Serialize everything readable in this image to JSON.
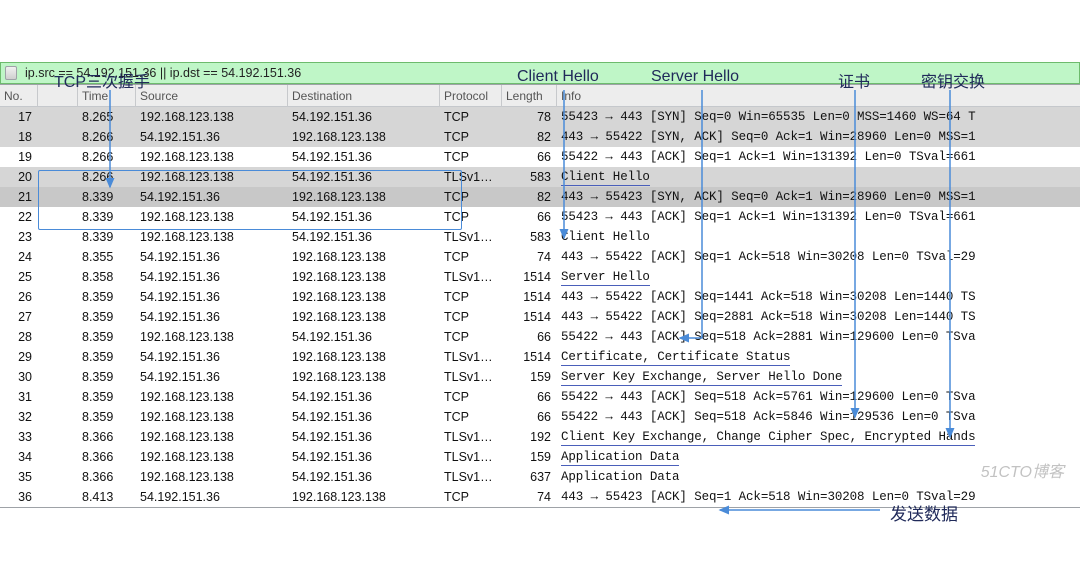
{
  "annotations": {
    "tcp_handshake": "TCP三次握手",
    "client_hello": "Client Hello",
    "server_hello": "Server Hello",
    "certificate": "证书",
    "key_exchange": "密钥交换",
    "send_data": "发送数据"
  },
  "filter": {
    "expression": "ip.src == 54.192.151.36 || ip.dst == 54.192.151.36"
  },
  "columns": {
    "c0": "No.",
    "c1": "",
    "c2": "Time",
    "c3": "Source",
    "c4": "Destination",
    "c5": "Protocol",
    "c6": "Length",
    "c7": "Info"
  },
  "rows": [
    {
      "no": "17",
      "time": "8.265",
      "src": "192.168.123.138",
      "dst": "54.192.151.36",
      "proto": "TCP",
      "len": "78",
      "info": "55423 → 443 [SYN] Seq=0 Win=65535 Len=0 MSS=1460 WS=64 T",
      "sel": true
    },
    {
      "no": "18",
      "time": "8.266",
      "src": "54.192.151.36",
      "dst": "192.168.123.138",
      "proto": "TCP",
      "len": "82",
      "info": "443 → 55422 [SYN, ACK] Seq=0 Ack=1 Win=28960 Len=0 MSS=1",
      "sel": true
    },
    {
      "no": "19",
      "time": "8.266",
      "src": "192.168.123.138",
      "dst": "54.192.151.36",
      "proto": "TCP",
      "len": "66",
      "info": "55422 → 443 [ACK] Seq=1 Ack=1 Win=131392 Len=0 TSval=661",
      "sel": false
    },
    {
      "no": "20",
      "time": "8.266",
      "src": "192.168.123.138",
      "dst": "54.192.151.36",
      "proto": "TLSv1…",
      "len": "583",
      "info": "Client Hello",
      "sel": true,
      "ul": true
    },
    {
      "no": "21",
      "time": "8.339",
      "src": "54.192.151.36",
      "dst": "192.168.123.138",
      "proto": "TCP",
      "len": "82",
      "info": "443 → 55423 [SYN, ACK] Seq=0 Ack=1 Win=28960 Len=0 MSS=1",
      "sel": true,
      "mark": true
    },
    {
      "no": "22",
      "time": "8.339",
      "src": "192.168.123.138",
      "dst": "54.192.151.36",
      "proto": "TCP",
      "len": "66",
      "info": "55423 → 443 [ACK] Seq=1 Ack=1 Win=131392 Len=0 TSval=661",
      "sel": false
    },
    {
      "no": "23",
      "time": "8.339",
      "src": "192.168.123.138",
      "dst": "54.192.151.36",
      "proto": "TLSv1…",
      "len": "583",
      "info": "Client Hello",
      "sel": false
    },
    {
      "no": "24",
      "time": "8.355",
      "src": "54.192.151.36",
      "dst": "192.168.123.138",
      "proto": "TCP",
      "len": "74",
      "info": "443 → 55422 [ACK] Seq=1 Ack=518 Win=30208 Len=0 TSval=29",
      "sel": false
    },
    {
      "no": "25",
      "time": "8.358",
      "src": "54.192.151.36",
      "dst": "192.168.123.138",
      "proto": "TLSv1…",
      "len": "1514",
      "info": "Server Hello",
      "sel": false,
      "ul": true
    },
    {
      "no": "26",
      "time": "8.359",
      "src": "54.192.151.36",
      "dst": "192.168.123.138",
      "proto": "TCP",
      "len": "1514",
      "info": "443 → 55422 [ACK] Seq=1441 Ack=518 Win=30208 Len=1440 TS",
      "sel": false
    },
    {
      "no": "27",
      "time": "8.359",
      "src": "54.192.151.36",
      "dst": "192.168.123.138",
      "proto": "TCP",
      "len": "1514",
      "info": "443 → 55422 [ACK] Seq=2881 Ack=518 Win=30208 Len=1440 TS",
      "sel": false
    },
    {
      "no": "28",
      "time": "8.359",
      "src": "192.168.123.138",
      "dst": "54.192.151.36",
      "proto": "TCP",
      "len": "66",
      "info": "55422 → 443 [ACK] Seq=518 Ack=2881 Win=129600 Len=0 TSva",
      "sel": false
    },
    {
      "no": "29",
      "time": "8.359",
      "src": "54.192.151.36",
      "dst": "192.168.123.138",
      "proto": "TLSv1…",
      "len": "1514",
      "info": "Certificate, Certificate Status",
      "sel": false,
      "ul": true
    },
    {
      "no": "30",
      "time": "8.359",
      "src": "54.192.151.36",
      "dst": "192.168.123.138",
      "proto": "TLSv1…",
      "len": "159",
      "info": "Server Key Exchange, Server Hello Done",
      "sel": false,
      "ul": true
    },
    {
      "no": "31",
      "time": "8.359",
      "src": "192.168.123.138",
      "dst": "54.192.151.36",
      "proto": "TCP",
      "len": "66",
      "info": "55422 → 443 [ACK] Seq=518 Ack=5761 Win=129600 Len=0 TSva",
      "sel": false
    },
    {
      "no": "32",
      "time": "8.359",
      "src": "192.168.123.138",
      "dst": "54.192.151.36",
      "proto": "TCP",
      "len": "66",
      "info": "55422 → 443 [ACK] Seq=518 Ack=5846 Win=129536 Len=0 TSva",
      "sel": false
    },
    {
      "no": "33",
      "time": "8.366",
      "src": "192.168.123.138",
      "dst": "54.192.151.36",
      "proto": "TLSv1…",
      "len": "192",
      "info": "Client Key Exchange, Change Cipher Spec, Encrypted Hands",
      "sel": false,
      "ul": true
    },
    {
      "no": "34",
      "time": "8.366",
      "src": "192.168.123.138",
      "dst": "54.192.151.36",
      "proto": "TLSv1…",
      "len": "159",
      "info": "Application Data",
      "sel": false,
      "ul": true
    },
    {
      "no": "35",
      "time": "8.366",
      "src": "192.168.123.138",
      "dst": "54.192.151.36",
      "proto": "TLSv1…",
      "len": "637",
      "info": "Application Data",
      "sel": false
    },
    {
      "no": "36",
      "time": "8.413",
      "src": "54.192.151.36",
      "dst": "192.168.123.138",
      "proto": "TCP",
      "len": "74",
      "info": "443 → 55423 [ACK] Seq=1 Ack=518 Win=30208 Len=0 TSval=29",
      "sel": false
    }
  ],
  "watermark": "51CTO博客"
}
